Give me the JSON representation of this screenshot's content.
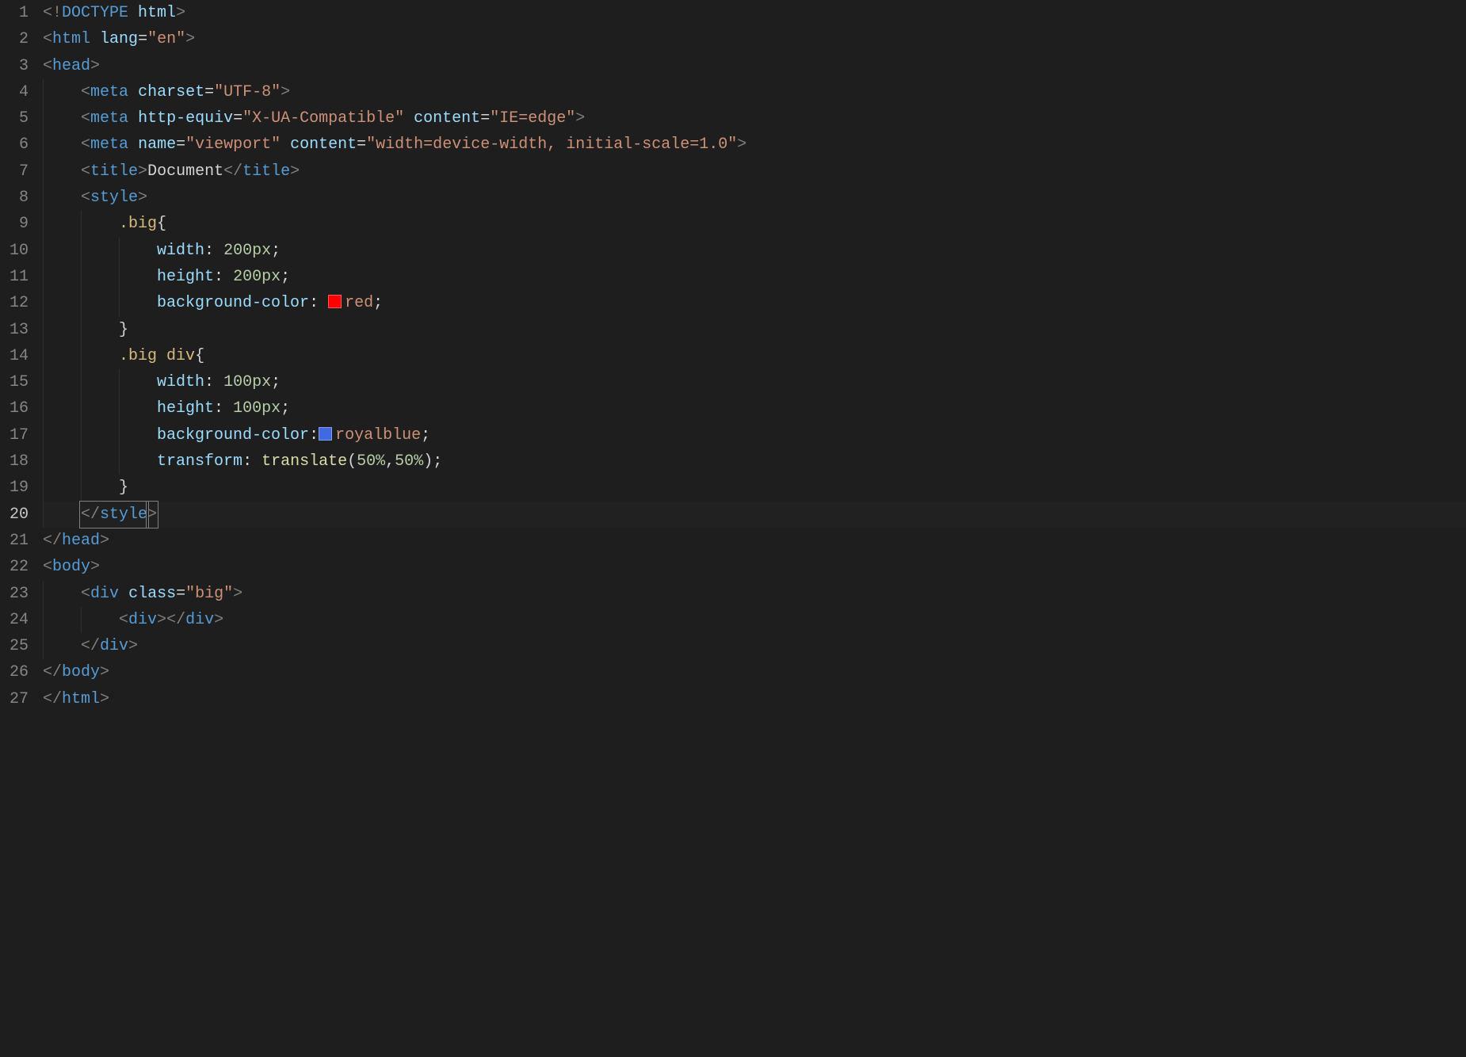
{
  "active_line": 20,
  "lines": [
    {
      "n": 1,
      "indent": 0,
      "guides": [],
      "tokens": [
        {
          "c": "punct",
          "t": "<!"
        },
        {
          "c": "doctype",
          "t": "DOCTYPE"
        },
        {
          "c": "text",
          "t": " "
        },
        {
          "c": "attrname",
          "t": "html"
        },
        {
          "c": "punct",
          "t": ">"
        }
      ]
    },
    {
      "n": 2,
      "indent": 0,
      "guides": [],
      "tokens": [
        {
          "c": "punct",
          "t": "<"
        },
        {
          "c": "tag",
          "t": "html"
        },
        {
          "c": "text",
          "t": " "
        },
        {
          "c": "attrname",
          "t": "lang"
        },
        {
          "c": "eq",
          "t": "="
        },
        {
          "c": "string",
          "t": "\"en\""
        },
        {
          "c": "punct",
          "t": ">"
        }
      ]
    },
    {
      "n": 3,
      "indent": 0,
      "guides": [],
      "tokens": [
        {
          "c": "punct",
          "t": "<"
        },
        {
          "c": "tag",
          "t": "head"
        },
        {
          "c": "punct",
          "t": ">"
        }
      ]
    },
    {
      "n": 4,
      "indent": 1,
      "guides": [
        1
      ],
      "tokens": [
        {
          "c": "punct",
          "t": "<"
        },
        {
          "c": "tag",
          "t": "meta"
        },
        {
          "c": "text",
          "t": " "
        },
        {
          "c": "attrname",
          "t": "charset"
        },
        {
          "c": "eq",
          "t": "="
        },
        {
          "c": "string",
          "t": "\"UTF-8\""
        },
        {
          "c": "punct",
          "t": ">"
        }
      ]
    },
    {
      "n": 5,
      "indent": 1,
      "guides": [
        1
      ],
      "tokens": [
        {
          "c": "punct",
          "t": "<"
        },
        {
          "c": "tag",
          "t": "meta"
        },
        {
          "c": "text",
          "t": " "
        },
        {
          "c": "attrname",
          "t": "http-equiv"
        },
        {
          "c": "eq",
          "t": "="
        },
        {
          "c": "string",
          "t": "\"X-UA-Compatible\""
        },
        {
          "c": "text",
          "t": " "
        },
        {
          "c": "attrname",
          "t": "content"
        },
        {
          "c": "eq",
          "t": "="
        },
        {
          "c": "string",
          "t": "\"IE=edge\""
        },
        {
          "c": "punct",
          "t": ">"
        }
      ]
    },
    {
      "n": 6,
      "indent": 1,
      "guides": [
        1
      ],
      "tokens": [
        {
          "c": "punct",
          "t": "<"
        },
        {
          "c": "tag",
          "t": "meta"
        },
        {
          "c": "text",
          "t": " "
        },
        {
          "c": "attrname",
          "t": "name"
        },
        {
          "c": "eq",
          "t": "="
        },
        {
          "c": "string",
          "t": "\"viewport\""
        },
        {
          "c": "text",
          "t": " "
        },
        {
          "c": "attrname",
          "t": "content"
        },
        {
          "c": "eq",
          "t": "="
        },
        {
          "c": "string",
          "t": "\"width=device-width, initial-scale=1.0\""
        },
        {
          "c": "punct",
          "t": ">"
        }
      ]
    },
    {
      "n": 7,
      "indent": 1,
      "guides": [
        1
      ],
      "tokens": [
        {
          "c": "punct",
          "t": "<"
        },
        {
          "c": "tag",
          "t": "title"
        },
        {
          "c": "punct",
          "t": ">"
        },
        {
          "c": "text",
          "t": "Document"
        },
        {
          "c": "punct",
          "t": "</"
        },
        {
          "c": "tag",
          "t": "title"
        },
        {
          "c": "punct",
          "t": ">"
        }
      ]
    },
    {
      "n": 8,
      "indent": 1,
      "guides": [
        1
      ],
      "tokens": [
        {
          "c": "punct",
          "t": "<"
        },
        {
          "c": "tag",
          "t": "style"
        },
        {
          "c": "punct",
          "t": ">"
        }
      ]
    },
    {
      "n": 9,
      "indent": 2,
      "guides": [
        1,
        2
      ],
      "tokens": [
        {
          "c": "sel",
          "t": ".big"
        },
        {
          "c": "brace",
          "t": "{"
        }
      ]
    },
    {
      "n": 10,
      "indent": 3,
      "guides": [
        1,
        2,
        3
      ],
      "tokens": [
        {
          "c": "prop",
          "t": "width"
        },
        {
          "c": "colon",
          "t": ": "
        },
        {
          "c": "num",
          "t": "200"
        },
        {
          "c": "unit",
          "t": "px"
        },
        {
          "c": "semi",
          "t": ";"
        }
      ]
    },
    {
      "n": 11,
      "indent": 3,
      "guides": [
        1,
        2,
        3
      ],
      "tokens": [
        {
          "c": "prop",
          "t": "height"
        },
        {
          "c": "colon",
          "t": ": "
        },
        {
          "c": "num",
          "t": "200"
        },
        {
          "c": "unit",
          "t": "px"
        },
        {
          "c": "semi",
          "t": ";"
        }
      ]
    },
    {
      "n": 12,
      "indent": 3,
      "guides": [
        1,
        2,
        3
      ],
      "tokens": [
        {
          "c": "prop",
          "t": "background-color"
        },
        {
          "c": "colon",
          "t": ": "
        },
        {
          "swatch": "sw-red"
        },
        {
          "c": "val",
          "t": "red"
        },
        {
          "c": "semi",
          "t": ";"
        }
      ]
    },
    {
      "n": 13,
      "indent": 2,
      "guides": [
        1,
        2
      ],
      "tokens": [
        {
          "c": "brace",
          "t": "}"
        }
      ]
    },
    {
      "n": 14,
      "indent": 2,
      "guides": [
        1,
        2
      ],
      "tokens": [
        {
          "c": "sel",
          "t": ".big"
        },
        {
          "c": "text",
          "t": " "
        },
        {
          "c": "sel",
          "t": "div"
        },
        {
          "c": "brace",
          "t": "{"
        }
      ]
    },
    {
      "n": 15,
      "indent": 3,
      "guides": [
        1,
        2,
        3
      ],
      "tokens": [
        {
          "c": "prop",
          "t": "width"
        },
        {
          "c": "colon",
          "t": ": "
        },
        {
          "c": "num",
          "t": "100"
        },
        {
          "c": "unit",
          "t": "px"
        },
        {
          "c": "semi",
          "t": ";"
        }
      ]
    },
    {
      "n": 16,
      "indent": 3,
      "guides": [
        1,
        2,
        3
      ],
      "tokens": [
        {
          "c": "prop",
          "t": "height"
        },
        {
          "c": "colon",
          "t": ": "
        },
        {
          "c": "num",
          "t": "100"
        },
        {
          "c": "unit",
          "t": "px"
        },
        {
          "c": "semi",
          "t": ";"
        }
      ]
    },
    {
      "n": 17,
      "indent": 3,
      "guides": [
        1,
        2,
        3
      ],
      "tokens": [
        {
          "c": "prop",
          "t": "background-color"
        },
        {
          "c": "colon",
          "t": ":"
        },
        {
          "swatch": "sw-royal"
        },
        {
          "c": "val",
          "t": "royalblue"
        },
        {
          "c": "semi",
          "t": ";"
        }
      ]
    },
    {
      "n": 18,
      "indent": 3,
      "guides": [
        1,
        2,
        3
      ],
      "tokens": [
        {
          "c": "prop",
          "t": "transform"
        },
        {
          "c": "colon",
          "t": ": "
        },
        {
          "c": "func",
          "t": "translate"
        },
        {
          "c": "paren",
          "t": "("
        },
        {
          "c": "num",
          "t": "50"
        },
        {
          "c": "unit",
          "t": "%"
        },
        {
          "c": "comma",
          "t": ","
        },
        {
          "c": "num",
          "t": "50"
        },
        {
          "c": "unit",
          "t": "%"
        },
        {
          "c": "paren",
          "t": ")"
        },
        {
          "c": "semi",
          "t": ";"
        }
      ]
    },
    {
      "n": 19,
      "indent": 2,
      "guides": [
        1,
        2
      ],
      "tokens": [
        {
          "c": "brace",
          "t": "}"
        }
      ]
    },
    {
      "n": 20,
      "indent": 1,
      "guides": [
        1
      ],
      "active": true,
      "tokens": [
        {
          "boxstart": true
        },
        {
          "c": "punct",
          "t": "</"
        },
        {
          "c": "tag",
          "t": "style"
        },
        {
          "boxend": true
        },
        {
          "c": "punct",
          "boxchar": true,
          "t": ">"
        }
      ]
    },
    {
      "n": 21,
      "indent": 0,
      "guides": [],
      "tokens": [
        {
          "c": "punct",
          "t": "</"
        },
        {
          "c": "tag",
          "t": "head"
        },
        {
          "c": "punct",
          "t": ">"
        }
      ]
    },
    {
      "n": 22,
      "indent": 0,
      "guides": [],
      "tokens": [
        {
          "c": "punct",
          "t": "<"
        },
        {
          "c": "tag",
          "t": "body"
        },
        {
          "c": "punct",
          "t": ">"
        }
      ]
    },
    {
      "n": 23,
      "indent": 1,
      "guides": [
        1
      ],
      "tokens": [
        {
          "c": "punct",
          "t": "<"
        },
        {
          "c": "tag",
          "t": "div"
        },
        {
          "c": "text",
          "t": " "
        },
        {
          "c": "attrname",
          "t": "class"
        },
        {
          "c": "eq",
          "t": "="
        },
        {
          "c": "string",
          "t": "\"big\""
        },
        {
          "c": "punct",
          "t": ">"
        }
      ]
    },
    {
      "n": 24,
      "indent": 2,
      "guides": [
        1,
        2
      ],
      "tokens": [
        {
          "c": "punct",
          "t": "<"
        },
        {
          "c": "tag",
          "t": "div"
        },
        {
          "c": "punct",
          "t": ">"
        },
        {
          "c": "punct",
          "t": "</"
        },
        {
          "c": "tag",
          "t": "div"
        },
        {
          "c": "punct",
          "t": ">"
        }
      ]
    },
    {
      "n": 25,
      "indent": 1,
      "guides": [
        1
      ],
      "tokens": [
        {
          "c": "punct",
          "t": "</"
        },
        {
          "c": "tag",
          "t": "div"
        },
        {
          "c": "punct",
          "t": ">"
        }
      ]
    },
    {
      "n": 26,
      "indent": 0,
      "guides": [],
      "tokens": [
        {
          "c": "punct",
          "t": "</"
        },
        {
          "c": "tag",
          "t": "body"
        },
        {
          "c": "punct",
          "t": ">"
        }
      ]
    },
    {
      "n": 27,
      "indent": 0,
      "guides": [],
      "tokens": [
        {
          "c": "punct",
          "t": "</"
        },
        {
          "c": "tag",
          "t": "html"
        },
        {
          "c": "punct",
          "t": ">"
        }
      ]
    }
  ]
}
